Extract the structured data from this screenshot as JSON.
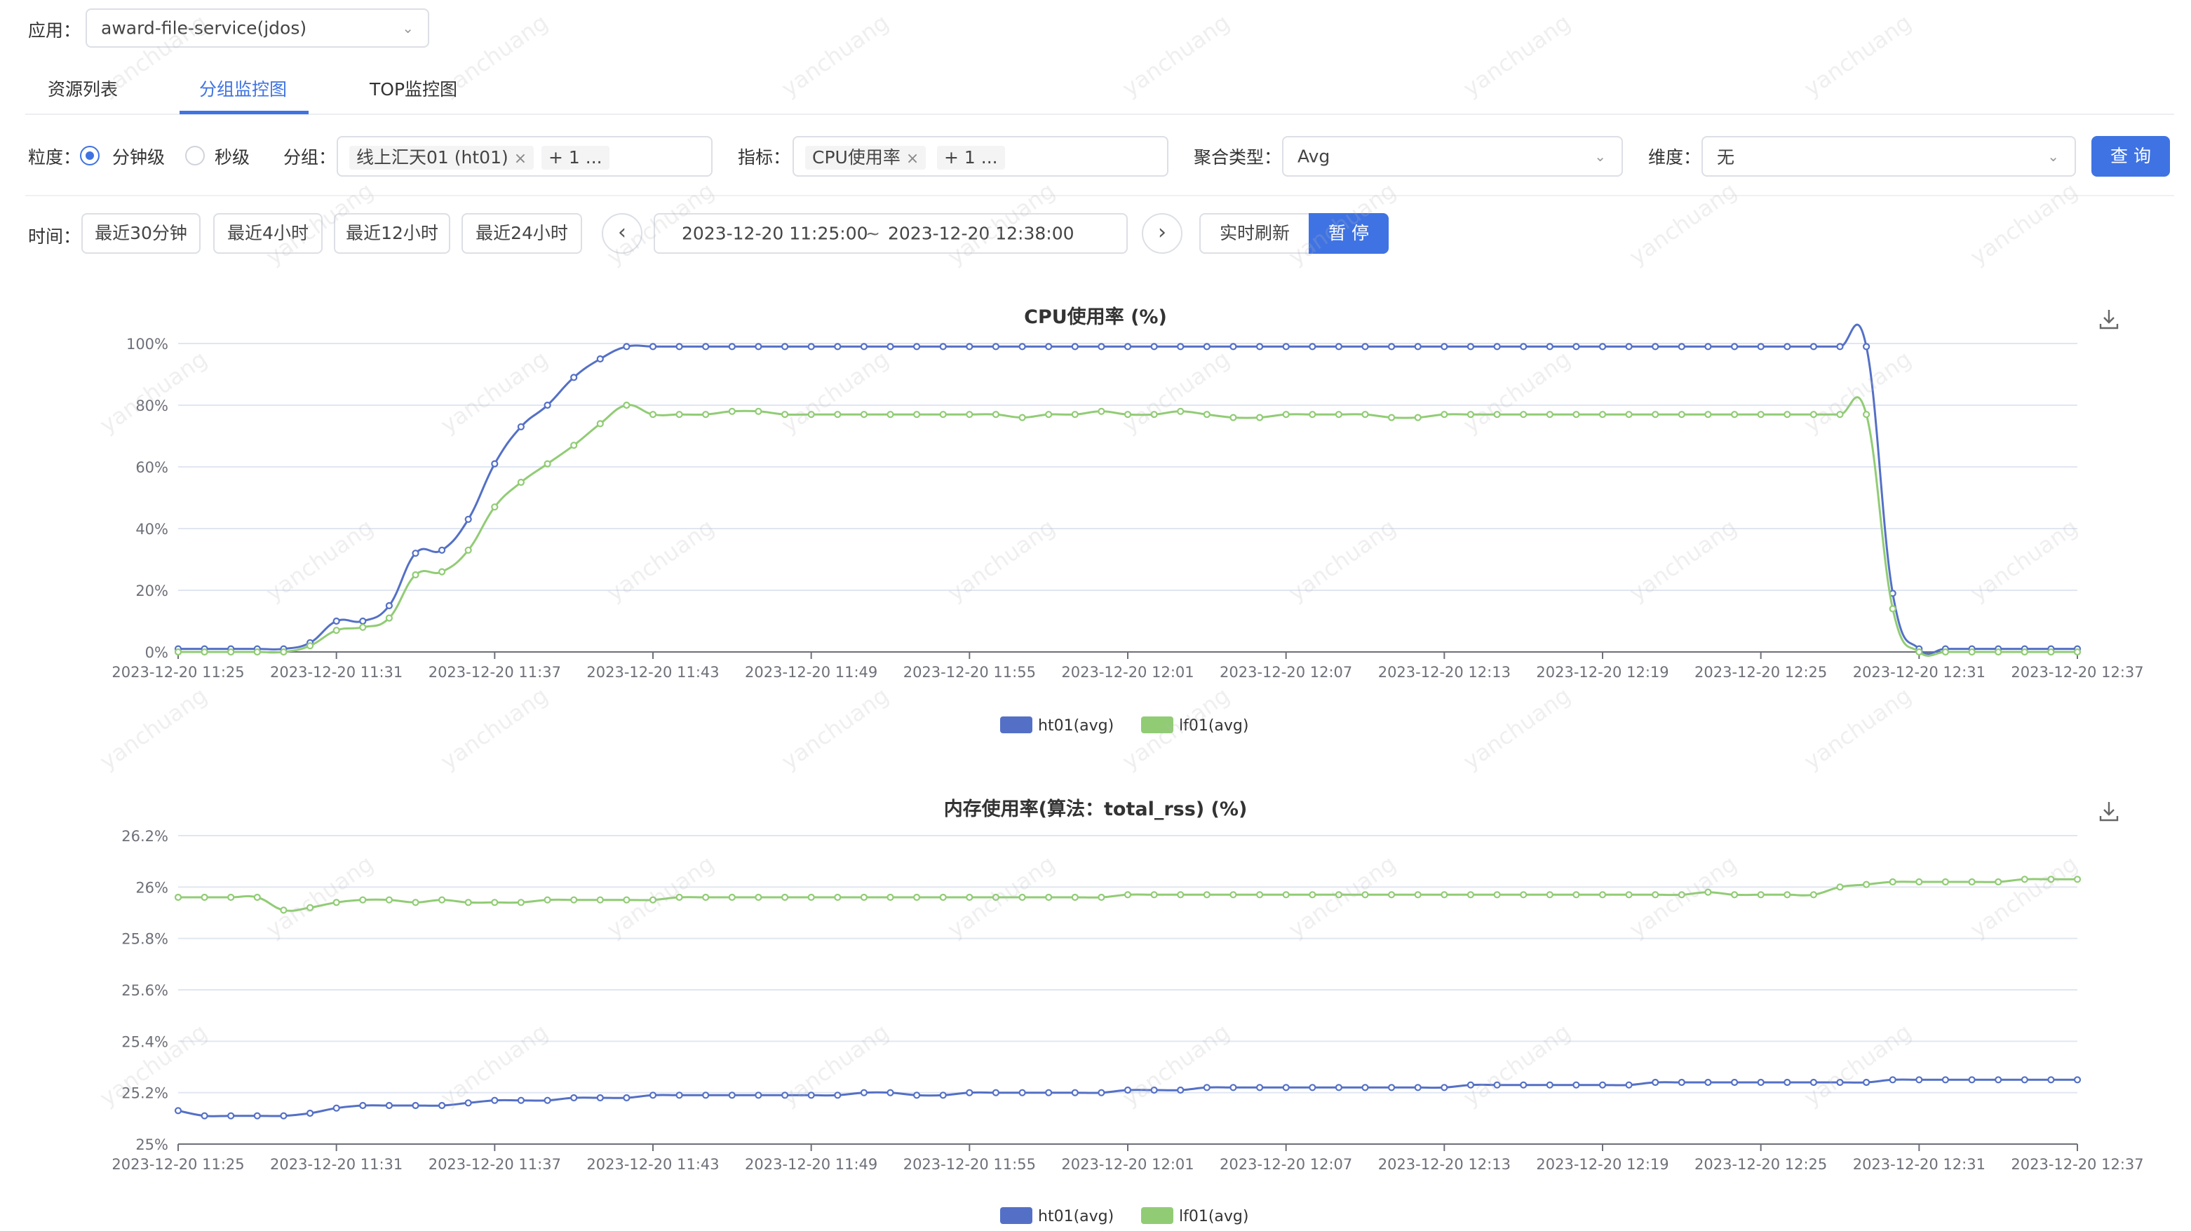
{
  "app": {
    "label": "应用：",
    "value": "award-file-service(jdos)"
  },
  "tabs": [
    {
      "label": "资源列表"
    },
    {
      "label": "分组监控图"
    },
    {
      "label": "TOP监控图"
    }
  ],
  "filters": {
    "granularity_label": "粒度：",
    "granularity_options": [
      "分钟级",
      "秒级"
    ],
    "granularity_selected": "分钟级",
    "group_label": "分组：",
    "group_tag": "线上汇天01 (ht01)",
    "group_more": "+ 1 ...",
    "metric_label": "指标：",
    "metric_tag": "CPU使用率",
    "metric_more": "+ 1 ...",
    "agg_label": "聚合类型：",
    "agg_value": "Avg",
    "dim_label": "维度：",
    "dim_value": "无",
    "query_button": "查 询"
  },
  "time": {
    "label": "时间：",
    "quick_ranges": [
      "最近30分钟",
      "最近4小时",
      "最近12小时",
      "最近24小时"
    ],
    "start": "2023-12-20 11:25:00",
    "separator": "~",
    "end": "2023-12-20 12:38:00",
    "realtime_refresh": "实时刷新",
    "pause": "暂 停"
  },
  "watermark": "yanchuang",
  "colors": {
    "accent": "#3f73e3",
    "series_ht01": "#5470c6",
    "series_lf01": "#91cc75"
  },
  "chart_data": [
    {
      "type": "line",
      "title": "CPU使用率 (%)",
      "x_ticks": [
        "2023-12-20 11:25",
        "2023-12-20 11:31",
        "2023-12-20 11:37",
        "2023-12-20 11:43",
        "2023-12-20 11:49",
        "2023-12-20 11:55",
        "2023-12-20 12:01",
        "2023-12-20 12:07",
        "2023-12-20 12:13",
        "2023-12-20 12:19",
        "2023-12-20 12:25",
        "2023-12-20 12:31",
        "2023-12-20 12:37"
      ],
      "y_ticks": [
        "0%",
        "20%",
        "40%",
        "60%",
        "80%",
        "100%"
      ],
      "ylim": [
        0,
        100
      ],
      "x_minutes": [
        0,
        72
      ],
      "series": [
        {
          "name": "ht01(avg)",
          "color": "#5470c6",
          "values": [
            1,
            1,
            1,
            1,
            1,
            3,
            10,
            10,
            15,
            32,
            33,
            43,
            61,
            73,
            80,
            89,
            95,
            99,
            99,
            99,
            99,
            99,
            99,
            99,
            99,
            99,
            99,
            99,
            99,
            99,
            99,
            99,
            99,
            99,
            99,
            99,
            99,
            99,
            99,
            99,
            99,
            99,
            99,
            99,
            99,
            99,
            99,
            99,
            99,
            99,
            99,
            99,
            99,
            99,
            99,
            99,
            99,
            99,
            99,
            99,
            99,
            99,
            99,
            99,
            99,
            19,
            1,
            1,
            1,
            1,
            1,
            1,
            1
          ]
        },
        {
          "name": "lf01(avg)",
          "color": "#91cc75",
          "values": [
            0,
            0,
            0,
            0,
            0,
            2,
            7,
            8,
            11,
            25,
            26,
            33,
            47,
            55,
            61,
            67,
            74,
            80,
            77,
            77,
            77,
            78,
            78,
            77,
            77,
            77,
            77,
            77,
            77,
            77,
            77,
            77,
            76,
            77,
            77,
            78,
            77,
            77,
            78,
            77,
            76,
            76,
            77,
            77,
            77,
            77,
            76,
            76,
            77,
            77,
            77,
            77,
            77,
            77,
            77,
            77,
            77,
            77,
            77,
            77,
            77,
            77,
            77,
            77,
            77,
            14,
            0,
            0,
            0,
            0,
            0,
            0,
            0
          ]
        }
      ]
    },
    {
      "type": "line",
      "title": "内存使用率(算法：total_rss) (%)",
      "x_ticks": [
        "2023-12-20 11:25",
        "2023-12-20 11:31",
        "2023-12-20 11:37",
        "2023-12-20 11:43",
        "2023-12-20 11:49",
        "2023-12-20 11:55",
        "2023-12-20 12:01",
        "2023-12-20 12:07",
        "2023-12-20 12:13",
        "2023-12-20 12:19",
        "2023-12-20 12:25",
        "2023-12-20 12:31",
        "2023-12-20 12:37"
      ],
      "y_ticks": [
        "25%",
        "25.2%",
        "25.4%",
        "25.6%",
        "25.8%",
        "26%",
        "26.2%"
      ],
      "ylim": [
        25,
        26.2
      ],
      "x_minutes": [
        0,
        72
      ],
      "series": [
        {
          "name": "ht01(avg)",
          "color": "#5470c6",
          "values": [
            25.13,
            25.11,
            25.11,
            25.11,
            25.11,
            25.12,
            25.14,
            25.15,
            25.15,
            25.15,
            25.15,
            25.16,
            25.17,
            25.17,
            25.17,
            25.18,
            25.18,
            25.18,
            25.19,
            25.19,
            25.19,
            25.19,
            25.19,
            25.19,
            25.19,
            25.19,
            25.2,
            25.2,
            25.19,
            25.19,
            25.2,
            25.2,
            25.2,
            25.2,
            25.2,
            25.2,
            25.21,
            25.21,
            25.21,
            25.22,
            25.22,
            25.22,
            25.22,
            25.22,
            25.22,
            25.22,
            25.22,
            25.22,
            25.22,
            25.23,
            25.23,
            25.23,
            25.23,
            25.23,
            25.23,
            25.23,
            25.24,
            25.24,
            25.24,
            25.24,
            25.24,
            25.24,
            25.24,
            25.24,
            25.24,
            25.25,
            25.25,
            25.25,
            25.25,
            25.25,
            25.25,
            25.25,
            25.25
          ]
        },
        {
          "name": "lf01(avg)",
          "color": "#91cc75",
          "values": [
            25.96,
            25.96,
            25.96,
            25.96,
            25.91,
            25.92,
            25.94,
            25.95,
            25.95,
            25.94,
            25.95,
            25.94,
            25.94,
            25.94,
            25.95,
            25.95,
            25.95,
            25.95,
            25.95,
            25.96,
            25.96,
            25.96,
            25.96,
            25.96,
            25.96,
            25.96,
            25.96,
            25.96,
            25.96,
            25.96,
            25.96,
            25.96,
            25.96,
            25.96,
            25.96,
            25.96,
            25.97,
            25.97,
            25.97,
            25.97,
            25.97,
            25.97,
            25.97,
            25.97,
            25.97,
            25.97,
            25.97,
            25.97,
            25.97,
            25.97,
            25.97,
            25.97,
            25.97,
            25.97,
            25.97,
            25.97,
            25.97,
            25.97,
            25.98,
            25.97,
            25.97,
            25.97,
            25.97,
            26.0,
            26.01,
            26.02,
            26.02,
            26.02,
            26.02,
            26.02,
            26.03,
            26.03,
            26.03
          ]
        }
      ]
    }
  ]
}
